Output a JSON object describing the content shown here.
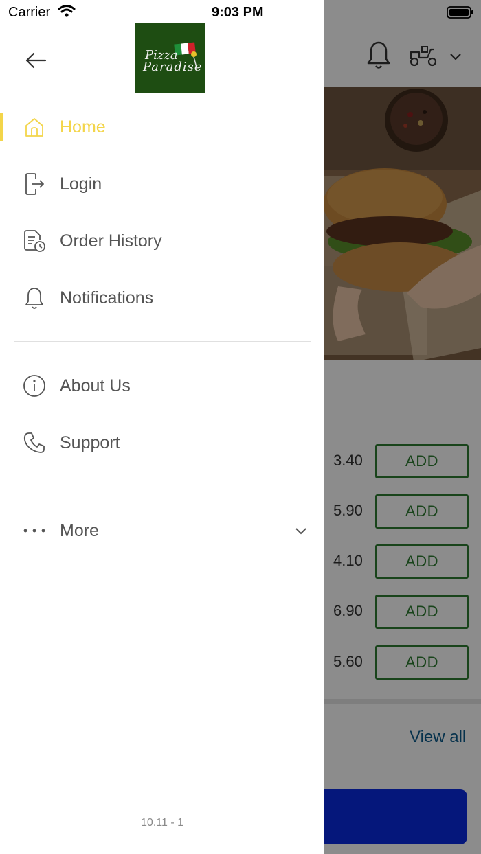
{
  "status_bar": {
    "carrier": "Carrier",
    "time": "9:03 PM"
  },
  "drawer": {
    "logo_line1": "Pizza",
    "logo_line2": "Paradise",
    "menu": [
      {
        "label": "Home",
        "icon": "home-icon",
        "active": true
      },
      {
        "label": "Login",
        "icon": "login-icon",
        "active": false
      },
      {
        "label": "Order History",
        "icon": "order-history-icon",
        "active": false
      },
      {
        "label": "Notifications",
        "icon": "bell-icon",
        "active": false
      },
      {
        "label": "About Us",
        "icon": "info-icon",
        "active": false
      },
      {
        "label": "Support",
        "icon": "phone-icon",
        "active": false
      },
      {
        "label": "More",
        "icon": "more-dots-icon",
        "active": false
      }
    ],
    "version": "10.11 - 1",
    "accent_color": "#f3d54a"
  },
  "background": {
    "items": [
      {
        "price": "3.40",
        "action": "ADD"
      },
      {
        "price": "5.90",
        "action": "ADD"
      },
      {
        "price": "4.10",
        "action": "ADD"
      },
      {
        "price": "6.90",
        "action": "ADD"
      },
      {
        "price": "5.60",
        "action": "ADD"
      }
    ],
    "view_all": "View all",
    "add_color": "#2e7d32",
    "cta_color": "#0a2ae0"
  }
}
